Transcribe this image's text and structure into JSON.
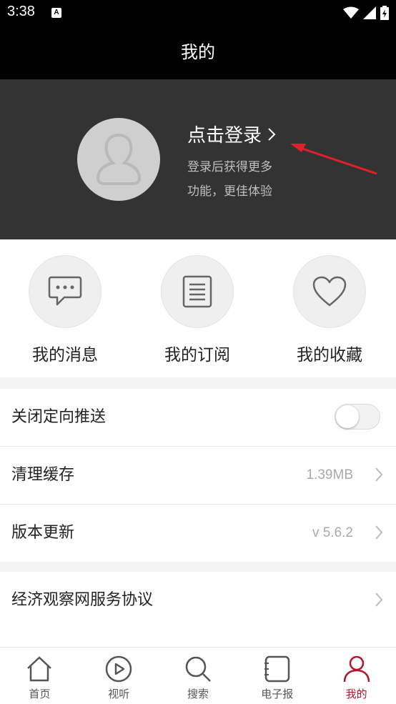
{
  "status_bar": {
    "time": "3:38",
    "notification_icon": "A"
  },
  "header": {
    "title": "我的"
  },
  "profile": {
    "login_label": "点击登录",
    "subtitle_line1": "登录后获得更多",
    "subtitle_line2": "功能，更佳体验"
  },
  "quick_actions": [
    {
      "label": "我的消息",
      "icon": "message-icon"
    },
    {
      "label": "我的订阅",
      "icon": "subscription-icon"
    },
    {
      "label": "我的收藏",
      "icon": "heart-icon"
    }
  ],
  "settings": {
    "targeted_push": {
      "label": "关闭定向推送",
      "enabled": false
    },
    "clear_cache": {
      "label": "清理缓存",
      "value": "1.39MB"
    },
    "version": {
      "label": "版本更新",
      "value": "v 5.6.2"
    },
    "agreement": {
      "label": "经济观察网服务协议"
    }
  },
  "tab_bar": {
    "items": [
      {
        "label": "首页",
        "icon": "home-icon"
      },
      {
        "label": "视听",
        "icon": "play-icon"
      },
      {
        "label": "搜索",
        "icon": "search-icon"
      },
      {
        "label": "电子报",
        "icon": "epaper-icon"
      },
      {
        "label": "我的",
        "icon": "user-icon"
      }
    ],
    "active_index": 4
  },
  "colors": {
    "accent": "#b5142c",
    "header_bg": "#000000",
    "profile_bg": "#333333",
    "annotation_arrow": "#e0202a"
  }
}
